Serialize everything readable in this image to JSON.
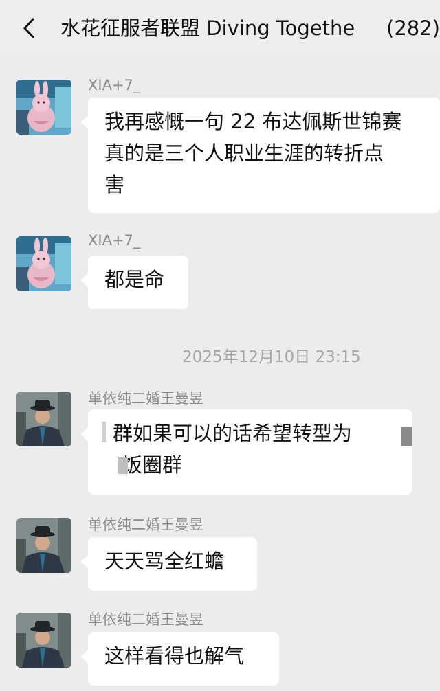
{
  "header": {
    "back_icon": "chevron-left-icon",
    "title": "水花征服者联盟 Diving Togethe",
    "member_count": "(282)"
  },
  "messages": [
    {
      "sender": "XIA+7_",
      "avatar": "plush-bunny-avatar",
      "lines": [
        "我再感慨一句 22 布达佩斯世锦赛",
        "真的是三个人职业生涯的转折点",
        "害"
      ]
    },
    {
      "sender": "XIA+7_",
      "avatar": "plush-bunny-avatar",
      "lines": [
        "都是命"
      ]
    },
    {
      "sender": "单依纯二婚王曼昱",
      "avatar": "man-in-hat-avatar",
      "lines": [
        "群如果可以的话希望转型为",
        "饭圈群"
      ]
    },
    {
      "sender": "单依纯二婚王曼昱",
      "avatar": "man-in-hat-avatar",
      "lines": [
        "天天骂全红蟾"
      ]
    },
    {
      "sender": "单依纯二婚王曼昱",
      "avatar": "man-in-hat-avatar",
      "lines": [
        "这样看得也解气"
      ]
    }
  ],
  "timestamp": "2025年12月10日 23:15",
  "colors": {
    "background": "#ececec",
    "bubble": "#ffffff",
    "sender_text": "#8c8c8c",
    "timestamp_text": "#a6a6a6"
  }
}
